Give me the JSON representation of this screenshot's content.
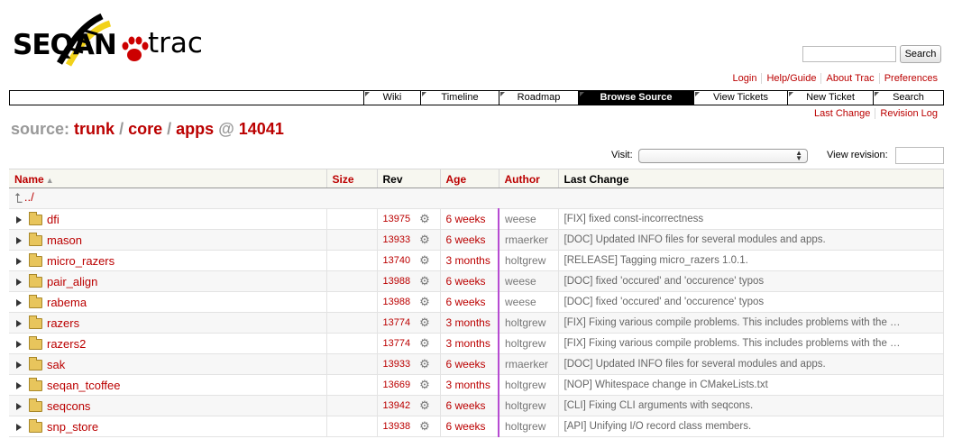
{
  "logo": {
    "brand": "SEQAN",
    "product": "trac"
  },
  "search": {
    "placeholder": "",
    "button_label": "Search"
  },
  "metanav": [
    "Login",
    "Help/Guide",
    "About Trac",
    "Preferences"
  ],
  "mainnav": [
    {
      "label": "Wiki",
      "active": false
    },
    {
      "label": "Timeline",
      "active": false
    },
    {
      "label": "Roadmap",
      "active": false
    },
    {
      "label": "Browse Source",
      "active": true
    },
    {
      "label": "View Tickets",
      "active": false
    },
    {
      "label": "New Ticket",
      "active": false
    },
    {
      "label": "Search",
      "active": false
    }
  ],
  "ctxtnav": [
    "Last Change",
    "Revision Log"
  ],
  "path": {
    "label": "source:",
    "segments": [
      "trunk",
      "core",
      "apps"
    ],
    "separator": "/",
    "at": "@",
    "revision": "14041"
  },
  "visit": {
    "label": "Visit:",
    "value": ""
  },
  "view_revision": {
    "label": "View revision:",
    "value": ""
  },
  "table": {
    "headers": {
      "name": "Name",
      "size": "Size",
      "rev": "Rev",
      "age": "Age",
      "author": "Author",
      "last_change": "Last Change"
    },
    "parent_link": "../",
    "rows": [
      {
        "name": "dfi",
        "rev": "13975",
        "age": "6 weeks",
        "author": "weese",
        "change": "[FIX] fixed const-incorrectness"
      },
      {
        "name": "mason",
        "rev": "13933",
        "age": "6 weeks",
        "author": "rmaerker",
        "change": "[DOC] Updated INFO files for several modules and apps."
      },
      {
        "name": "micro_razers",
        "rev": "13740",
        "age": "3 months",
        "author": "holtgrew",
        "change": "[RELEASE] Tagging micro_razers 1.0.1."
      },
      {
        "name": "pair_align",
        "rev": "13988",
        "age": "6 weeks",
        "author": "weese",
        "change": "[DOC] fixed 'occured' and 'occurence' typos"
      },
      {
        "name": "rabema",
        "rev": "13988",
        "age": "6 weeks",
        "author": "weese",
        "change": "[DOC] fixed 'occured' and 'occurence' typos"
      },
      {
        "name": "razers",
        "rev": "13774",
        "age": "3 months",
        "author": "holtgrew",
        "change": "[FIX] Fixing various compile problems. This includes problems with the …"
      },
      {
        "name": "razers2",
        "rev": "13774",
        "age": "3 months",
        "author": "holtgrew",
        "change": "[FIX] Fixing various compile problems. This includes problems with the …"
      },
      {
        "name": "sak",
        "rev": "13933",
        "age": "6 weeks",
        "author": "rmaerker",
        "change": "[DOC] Updated INFO files for several modules and apps."
      },
      {
        "name": "seqan_tcoffee",
        "rev": "13669",
        "age": "3 months",
        "author": "holtgrew",
        "change": "[NOP] Whitespace change in CMakeLists.txt"
      },
      {
        "name": "seqcons",
        "rev": "13942",
        "age": "6 weeks",
        "author": "holtgrew",
        "change": "[CLI] Fixing CLI arguments with seqcons."
      },
      {
        "name": "snp_store",
        "rev": "13938",
        "age": "6 weeks",
        "author": "holtgrew",
        "change": "[API] Unifying I/O record class members."
      }
    ]
  },
  "colors": {
    "link": "#bb0000",
    "age_bar": "#b64bd2",
    "nav_active": "#000000"
  }
}
